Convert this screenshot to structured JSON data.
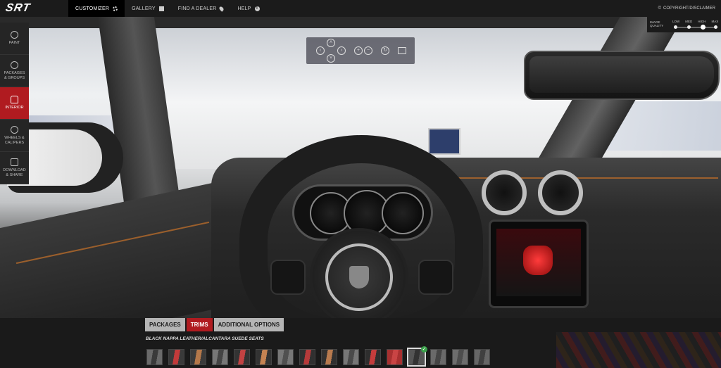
{
  "header": {
    "logo": "SRT",
    "nav": [
      {
        "label": "CUSTOMIZER",
        "icon": "gear-icon"
      },
      {
        "label": "GALLERY",
        "icon": "grid-icon"
      },
      {
        "label": "FIND A DEALER",
        "icon": "map-pin-icon"
      },
      {
        "label": "HELP",
        "icon": "info-icon"
      }
    ],
    "copyright": "COPYRIGHT/DISCLAIMER",
    "copyright_icon_glyph": "©"
  },
  "sidebar": {
    "items": [
      {
        "label": "PAINT",
        "icon": "paint-icon"
      },
      {
        "label": "PACKAGES\n& GROUPS",
        "icon": "gauge-icon"
      },
      {
        "label": "INTERIOR",
        "icon": "seat-icon",
        "active": true
      },
      {
        "label": "WHEELS &\nCALIPERS",
        "icon": "wheel-icon"
      },
      {
        "label": "DOWNLOAD\n& SHARE",
        "icon": "camera-icon"
      }
    ]
  },
  "camera_controls": {
    "buttons": [
      "rotate-left",
      "rotate-up",
      "rotate-down",
      "rotate-right",
      "zoom-in",
      "zoom-out",
      "reset-view",
      "fullscreen"
    ]
  },
  "image_quality": {
    "label": "IMAGE\nQUALITY",
    "options": [
      "LOW",
      "MED",
      "HIGH",
      "MAX"
    ],
    "selected": "HIGH"
  },
  "options_panel": {
    "tabs": [
      "PACKAGES",
      "TRIMS",
      "ADDITIONAL OPTIONS"
    ],
    "active_tab": "TRIMS",
    "selected_label": "BLACK NAPPA LEATHER/ALCANTARA SUEDE SEATS",
    "swatches": [
      {
        "color": "#3a3a3a",
        "accent": "#6a6a6a"
      },
      {
        "color": "#c13a3a",
        "accent": "#3a3a3a"
      },
      {
        "color": "#b5784a",
        "accent": "#3a3a3a"
      },
      {
        "color": "#444444",
        "accent": "#777777"
      },
      {
        "color": "#c24242",
        "accent": "#333333"
      },
      {
        "color": "#c58352",
        "accent": "#333333"
      },
      {
        "color": "#505050",
        "accent": "#777777"
      },
      {
        "color": "#b73a3a",
        "accent": "#303030"
      },
      {
        "color": "#b87a4e",
        "accent": "#303030"
      },
      {
        "color": "#4a4a4a",
        "accent": "#777777"
      },
      {
        "color": "#c43c3c",
        "accent": "#2e2e2e"
      },
      {
        "color": "#c94444",
        "accent": "#a83030"
      },
      {
        "color": "#333333",
        "accent": "#555555",
        "selected": true
      },
      {
        "color": "#454545",
        "accent": "#6a6a6a"
      },
      {
        "color": "#4d4d4d",
        "accent": "#6d6d6d"
      },
      {
        "color": "#404040",
        "accent": "#666666"
      }
    ]
  },
  "colors": {
    "accent_red": "#b01b20",
    "bar_bg": "#1b1b1b",
    "check_green": "#3aa14a"
  }
}
